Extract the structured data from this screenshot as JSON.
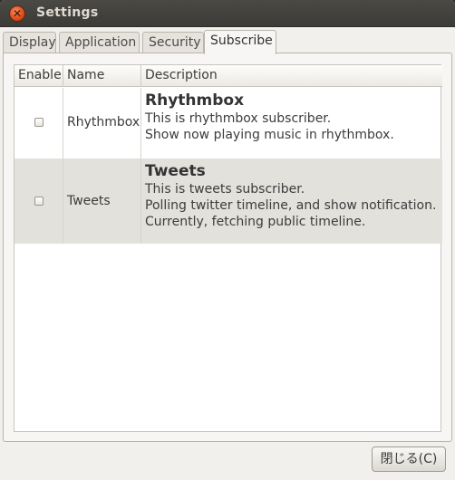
{
  "window": {
    "title": "Settings",
    "close_glyph": "✕"
  },
  "tabs": [
    {
      "label": "Display"
    },
    {
      "label": "Application"
    },
    {
      "label": "Security"
    },
    {
      "label": "Subscribe",
      "active": true
    }
  ],
  "table": {
    "columns": [
      "Enable",
      "Name",
      "Description"
    ],
    "rows": [
      {
        "enabled": false,
        "name": "Rhythmbox",
        "title": "Rhythmbox",
        "lines": [
          "This is rhythmbox subscriber.",
          "Show now playing music in rhythmbox."
        ]
      },
      {
        "enabled": false,
        "name": "Tweets",
        "title": "Tweets",
        "lines": [
          "This is tweets subscriber.",
          "Polling twitter timeline, and show notification.",
          "Currently, fetching public timeline."
        ]
      }
    ]
  },
  "footer": {
    "close_label": "閉じる(C)"
  },
  "colors": {
    "titlebar": "#3c3b37",
    "close_button": "#df4b16",
    "window_bg": "#f1f0ec",
    "selected_row": "#e3e1dc"
  }
}
